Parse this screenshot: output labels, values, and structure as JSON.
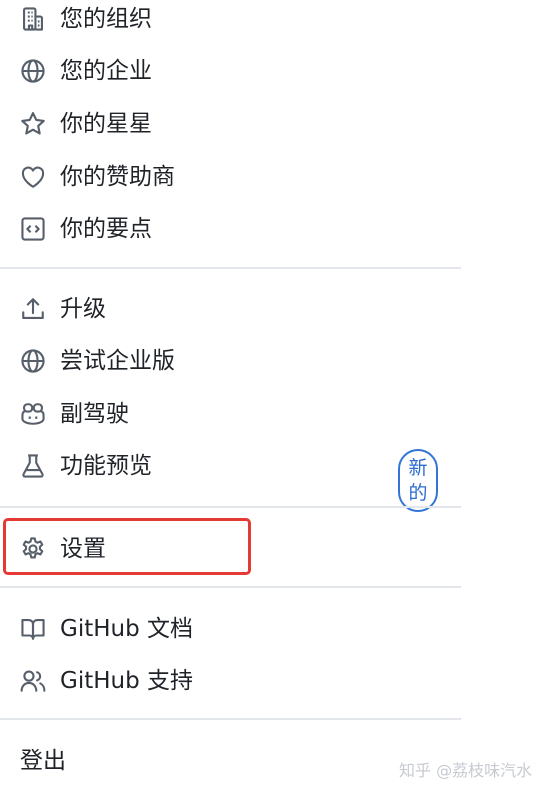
{
  "menu": {
    "group1": [
      {
        "label": "您的组织",
        "icon": "organization-icon"
      },
      {
        "label": "您的企业",
        "icon": "globe-icon"
      },
      {
        "label": "你的星星",
        "icon": "star-icon"
      },
      {
        "label": "你的赞助商",
        "icon": "heart-icon"
      },
      {
        "label": "你的要点",
        "icon": "code-square-icon"
      }
    ],
    "group2": [
      {
        "label": "升级",
        "icon": "upload-icon"
      },
      {
        "label": "尝试企业版",
        "icon": "globe-icon"
      },
      {
        "label": "副驾驶",
        "icon": "copilot-icon"
      },
      {
        "label": "功能预览",
        "icon": "beaker-icon",
        "badge": "新的"
      }
    ],
    "group3": [
      {
        "label": "设置",
        "icon": "gear-icon"
      }
    ],
    "group4": [
      {
        "label": "GitHub 文档",
        "icon": "book-icon"
      },
      {
        "label": "GitHub 支持",
        "icon": "people-icon"
      }
    ],
    "group5": [
      {
        "label": "登出"
      }
    ]
  },
  "colors": {
    "highlight_border": "#e53935",
    "badge": "#3275d6",
    "divider": "#e3e6ea"
  },
  "watermark": "知乎 @荔枝味汽水"
}
